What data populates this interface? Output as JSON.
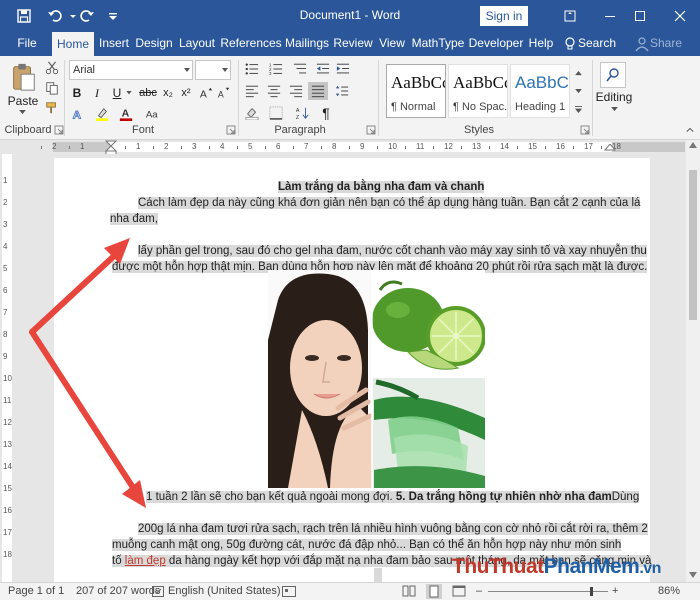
{
  "window": {
    "title": "Document1  -  Word",
    "signin_label": "Sign in"
  },
  "tabs": [
    {
      "label": "File"
    },
    {
      "label": "Home"
    },
    {
      "label": "Insert"
    },
    {
      "label": "Design"
    },
    {
      "label": "Layout"
    },
    {
      "label": "References"
    },
    {
      "label": "Mailings"
    },
    {
      "label": "Review"
    },
    {
      "label": "View"
    },
    {
      "label": "MathType"
    },
    {
      "label": "Developer"
    },
    {
      "label": "Help"
    },
    {
      "label": "Search"
    },
    {
      "label": "Share"
    }
  ],
  "ribbon": {
    "clipboard": {
      "paste_label": "Paste",
      "group_label": "Clipboard"
    },
    "font": {
      "font_name": "Arial",
      "font_size": "",
      "group_label": "Font"
    },
    "paragraph": {
      "group_label": "Paragraph"
    },
    "styles": {
      "group_label": "Styles",
      "items": [
        {
          "sample": "AaBbCcI",
          "name": "¶ Normal"
        },
        {
          "sample": "AaBbCcI",
          "name": "¶ No Spac..."
        },
        {
          "sample": "AaBbCc",
          "name": "Heading 1"
        }
      ]
    },
    "editing": {
      "label": "Editing"
    }
  },
  "ruler": {
    "numbers": [
      "2",
      "1",
      "1",
      "2",
      "3",
      "4",
      "5",
      "6",
      "7",
      "8",
      "9",
      "10",
      "11",
      "12",
      "13",
      "14",
      "15",
      "16",
      "17",
      "18"
    ],
    "vnumbers": [
      "1",
      "2",
      "3",
      "4",
      "5",
      "6",
      "7",
      "8",
      "9",
      "10",
      "11",
      "12",
      "13",
      "14",
      "15",
      "16",
      "17",
      "18"
    ]
  },
  "document": {
    "title": "Làm trắng da bằng nha đam và chanh",
    "p1_line1": "Cách làm đẹp da này cũng khá đơn giản nên bạn có thể áp dụng hàng tuần. Bạn cắt 2 cạnh của lá",
    "p1_line2": "nha đam,",
    "p2_line1": "lấy phần gel trong, sau đó cho gel nha đam, nước cốt chanh vào máy xay sinh tố và xay nhuyễn thu",
    "p2_line2": "được một hỗn hợp thật mịn. Bạn dùng hỗn hợp này lên mặt để khoảng 20 phút rồi rửa sạch mặt là được.",
    "p3_text": "1 tuần 2 lần sẽ cho bạn kết quả ngoài mong đợi.",
    "p3_heading": "5. Da trắng hồng tự nhiên nhờ nha đam",
    "p3_tail": "Dùng",
    "p4_line1": "200g lá nha đam tươi rửa sạch, rạch trên lá nhiều hình vuông bằng con cờ nhỏ rồi cắt rời ra, thêm 2",
    "p4_line2": "muỗng canh mật ong, 50g đường cát, nước đá đập nhỏ... Bạn có thể ăn hỗn hợp này như món sinh",
    "p4_line3_pre": "tố",
    "p4_line3_link": "làm đẹp",
    "p4_line3_post": "da hàng ngày kết hợp với đắp mặt nạ nha đam bảo sau một tháng, da mặt bạn sẽ căng mịn và"
  },
  "status": {
    "page": "Page 1 of 1",
    "words": "207 of 207 words",
    "language": "English (United States)",
    "zoom": "86%"
  },
  "watermark": {
    "part1": "Thu",
    "part2": "Thuat",
    "part3": "PhanMem",
    "part4": ".vn"
  },
  "colors": {
    "word_blue": "#2b579a",
    "arrow_red": "#e8453c",
    "selection_grey": "#d9d9d9"
  }
}
